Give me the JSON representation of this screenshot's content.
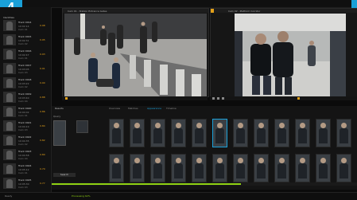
{
  "badge": "4",
  "sidebar": {
    "header": "Identities",
    "items": [
      {
        "name": "Track 0014",
        "time": "10:02:14",
        "cam": "Cam 01",
        "score": "0.98"
      },
      {
        "name": "Track 0015",
        "time": "10:02:31",
        "cam": "Cam 02",
        "score": "0.95"
      },
      {
        "name": "Track 0016",
        "time": "10:02:47",
        "cam": "Cam 01",
        "score": "0.93"
      },
      {
        "name": "Track 0017",
        "time": "10:03:05",
        "cam": "Cam 03",
        "score": "0.91"
      },
      {
        "name": "Track 0018",
        "time": "10:03:22",
        "cam": "Cam 02",
        "score": "0.90"
      },
      {
        "name": "Track 0019",
        "time": "10:03:40",
        "cam": "Cam 04",
        "score": "0.88"
      },
      {
        "name": "Track 0020",
        "time": "10:04:02",
        "cam": "Cam 01",
        "score": "0.86"
      },
      {
        "name": "Track 0021",
        "time": "10:04:19",
        "cam": "Cam 03",
        "score": "0.84"
      },
      {
        "name": "Track 0022",
        "time": "10:04:35",
        "cam": "Cam 02",
        "score": "0.82"
      },
      {
        "name": "Track 0023",
        "time": "10:04:58",
        "cam": "Cam 04",
        "score": "0.80"
      },
      {
        "name": "Track 0024",
        "time": "10:05:12",
        "cam": "Cam 01",
        "score": "0.79"
      },
      {
        "name": "Track 0025",
        "time": "10:05:30",
        "cam": "Cam 03",
        "score": "0.77"
      }
    ]
  },
  "cameras": {
    "left": {
      "title": "Cam 01 - Station Entrance Gates"
    },
    "right": {
      "title": "Cam 02 - Platform Corridor"
    }
  },
  "results": {
    "header": "Results",
    "tabs": [
      "Overview",
      "Matches",
      "Appearance",
      "Timeline"
    ],
    "active_tab": 2,
    "query_label": "Query",
    "action_label": "Search",
    "accent": "#8fd113",
    "highlight": "#1aa0d8"
  },
  "timeline": {
    "progress": 0.62
  },
  "status": {
    "left": "Ready",
    "right": "Processing 62%"
  }
}
